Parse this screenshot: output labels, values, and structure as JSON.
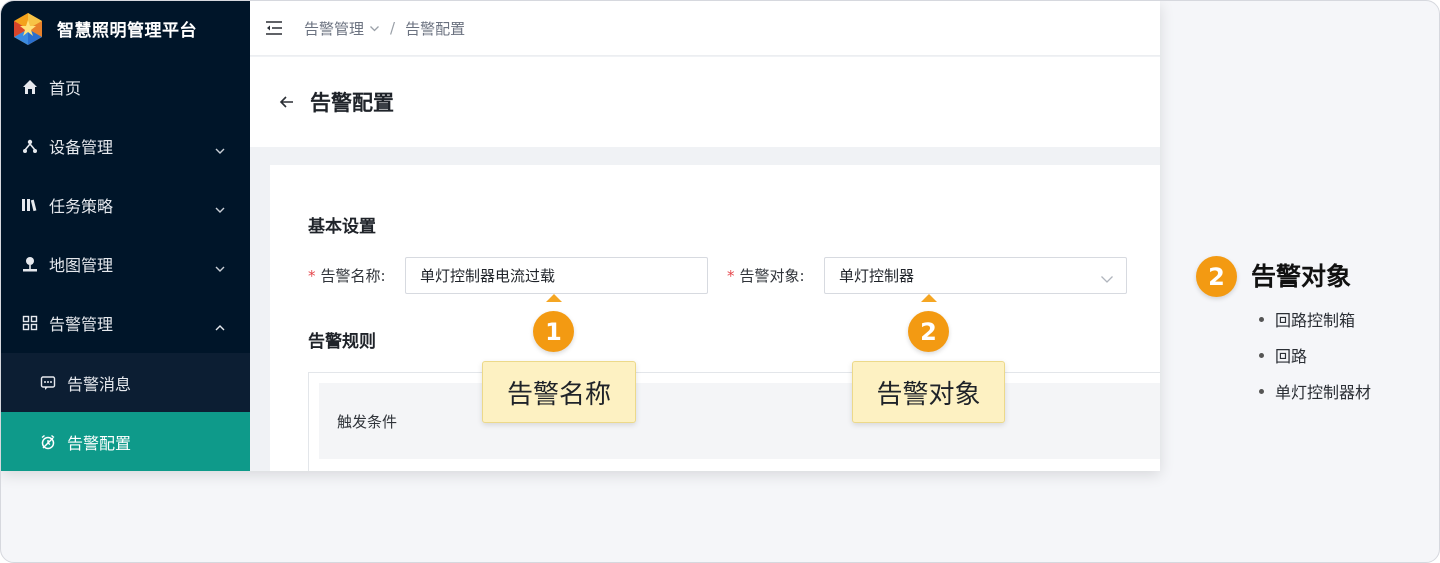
{
  "app": {
    "title": "智慧照明管理平台"
  },
  "sidebar": {
    "items": [
      {
        "label": "首页",
        "icon": "home-icon"
      },
      {
        "label": "设备管理",
        "icon": "device-tree-icon"
      },
      {
        "label": "任务策略",
        "icon": "books-icon"
      },
      {
        "label": "地图管理",
        "icon": "map-pin-icon"
      },
      {
        "label": "告警管理",
        "icon": "grid-icon",
        "expanded": true
      }
    ],
    "subitems": [
      {
        "label": "告警消息",
        "icon": "message-icon"
      },
      {
        "label": "告警配置",
        "icon": "alarm-clock-icon",
        "active": true
      }
    ],
    "active_color": "#0e9a8a",
    "bg_color": "#001529"
  },
  "breadcrumb": {
    "parent": "告警管理",
    "current": "告警配置"
  },
  "page": {
    "title": "告警配置"
  },
  "form": {
    "basic_section": "基本设置",
    "alarm_name_label": "告警名称:",
    "alarm_name_value": "单灯控制器电流过载",
    "alarm_target_label": "告警对象:",
    "alarm_target_value": "单灯控制器",
    "rules_section": "告警规则",
    "trigger_label": "触发条件"
  },
  "annotations": {
    "badge1": "1",
    "tag1": "告警名称",
    "badge2": "2",
    "tag2": "告警对象",
    "accent": "#f39a12"
  },
  "legend": {
    "badge": "2",
    "title": "告警对象",
    "options": [
      "回路控制箱",
      "回路",
      "单灯控制器材"
    ]
  }
}
